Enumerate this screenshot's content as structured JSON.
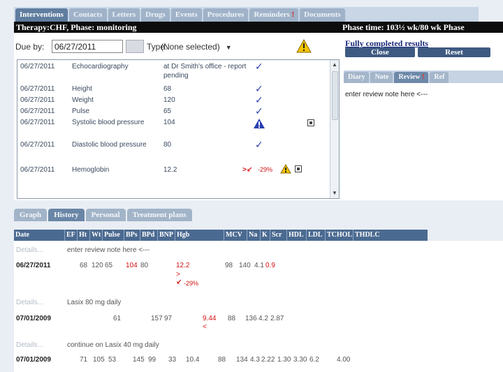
{
  "top_tabs": [
    {
      "label": "Interventions",
      "active": true
    },
    {
      "label": "Contacts"
    },
    {
      "label": "Letters"
    },
    {
      "label": "Drugs"
    },
    {
      "label": "Events"
    },
    {
      "label": "Procedures"
    },
    {
      "label": "Reminders",
      "badge": "!"
    },
    {
      "label": "Documents"
    }
  ],
  "phase": {
    "therapy": "Therapy:CHF, Phase: monitoring",
    "time": "Phase time: 103½ wk/80 wk  Phase"
  },
  "filter": {
    "due_label": "Due by:",
    "due_value": "06/27/2011",
    "type_label": "Type:",
    "type_value": "(None selected)"
  },
  "results": [
    {
      "date": "06/27/2011",
      "test": "Echocardiography",
      "value": "at Dr Smith's office - report pending",
      "status": "check"
    },
    {
      "date": "06/27/2011",
      "test": "Height",
      "value": "68",
      "status": "check"
    },
    {
      "date": "06/27/2011",
      "test": "Weight",
      "value": "120",
      "status": "check"
    },
    {
      "date": "06/27/2011",
      "test": "Pulse",
      "value": "65",
      "status": "check"
    },
    {
      "date": "06/27/2011",
      "test": "Systolic blood pressure",
      "value": "104",
      "status": "alert"
    },
    {
      "date": "06/27/2011",
      "test": "Diastolic blood pressure",
      "value": "80",
      "status": "check"
    },
    {
      "date": "06/27/2011",
      "test": "Hemoglobin",
      "value": "12.2",
      "status": "down",
      "trend": "-29%"
    }
  ],
  "right_panel": {
    "title": "Fully completed results",
    "close_label": "Close",
    "reset_label": "Reset",
    "sub_tabs": [
      {
        "label": "Diary"
      },
      {
        "label": "Note"
      },
      {
        "label": "Review",
        "active": true,
        "badge": "!"
      },
      {
        "label": "Ref"
      }
    ],
    "review_note": "enter review note here  <---"
  },
  "bottom_tabs": [
    {
      "label": "Graph"
    },
    {
      "label": "History",
      "active": true
    },
    {
      "label": "Personal"
    },
    {
      "label": "Treatment plans"
    }
  ],
  "history": {
    "columns": [
      "Date",
      "EF",
      "Ht",
      "Wt",
      "Pulse",
      "BPs",
      "BPd",
      "BNP",
      "Hgb",
      "MCV",
      "Na",
      "K",
      "Scr",
      "HDL",
      "LDL",
      "TCHOL",
      "THDLC"
    ],
    "details_label": "Details...",
    "entries": [
      {
        "note": "enter review note here  <---",
        "date": "06/27/2011",
        "ef": "",
        "ht": "68",
        "wt": "120",
        "pulse": "65",
        "bps": "104",
        "bpd": "80",
        "bnp": "",
        "hgb": "12.2",
        "hgb_flag": ">",
        "hgb_trend": "-29%",
        "mcv": "98",
        "na": "140",
        "k": "4.1",
        "scr": "0.9",
        "hdl": "",
        "ldl": "",
        "tchol": "",
        "thdlc": ""
      },
      {
        "note": "Lasix 80 mg daily",
        "date": "07/01/2009",
        "ef": "",
        "ht": "",
        "wt": "",
        "pulse": "61",
        "bps": "157",
        "bpd": "97",
        "bnp": "",
        "hgb": "9.44",
        "hgb_flag": "<",
        "mcv": "88",
        "na": "136",
        "k": "4.2",
        "scr": "2.87",
        "hdl": "",
        "ldl": "",
        "tchol": "",
        "thdlc": ""
      },
      {
        "note": "continue on Lasix 40 mg daily",
        "date": "07/01/2009",
        "ef": "",
        "ht": "71",
        "wt": "105",
        "pulse": "53",
        "bps": "145",
        "bpd": "99",
        "bnp": "33",
        "hgb": "10.4",
        "mcv": "88",
        "na": "134",
        "k": "4.3",
        "scr": "2.22",
        "hdl": "1.30",
        "ldl": "3.30",
        "tchol": "6.2",
        "thdlc": "4.00"
      }
    ]
  },
  "colors": {
    "accent": "#5f7d9f",
    "alert": "#d41212",
    "check": "#2a3fb0",
    "warning": "#f5c400"
  }
}
